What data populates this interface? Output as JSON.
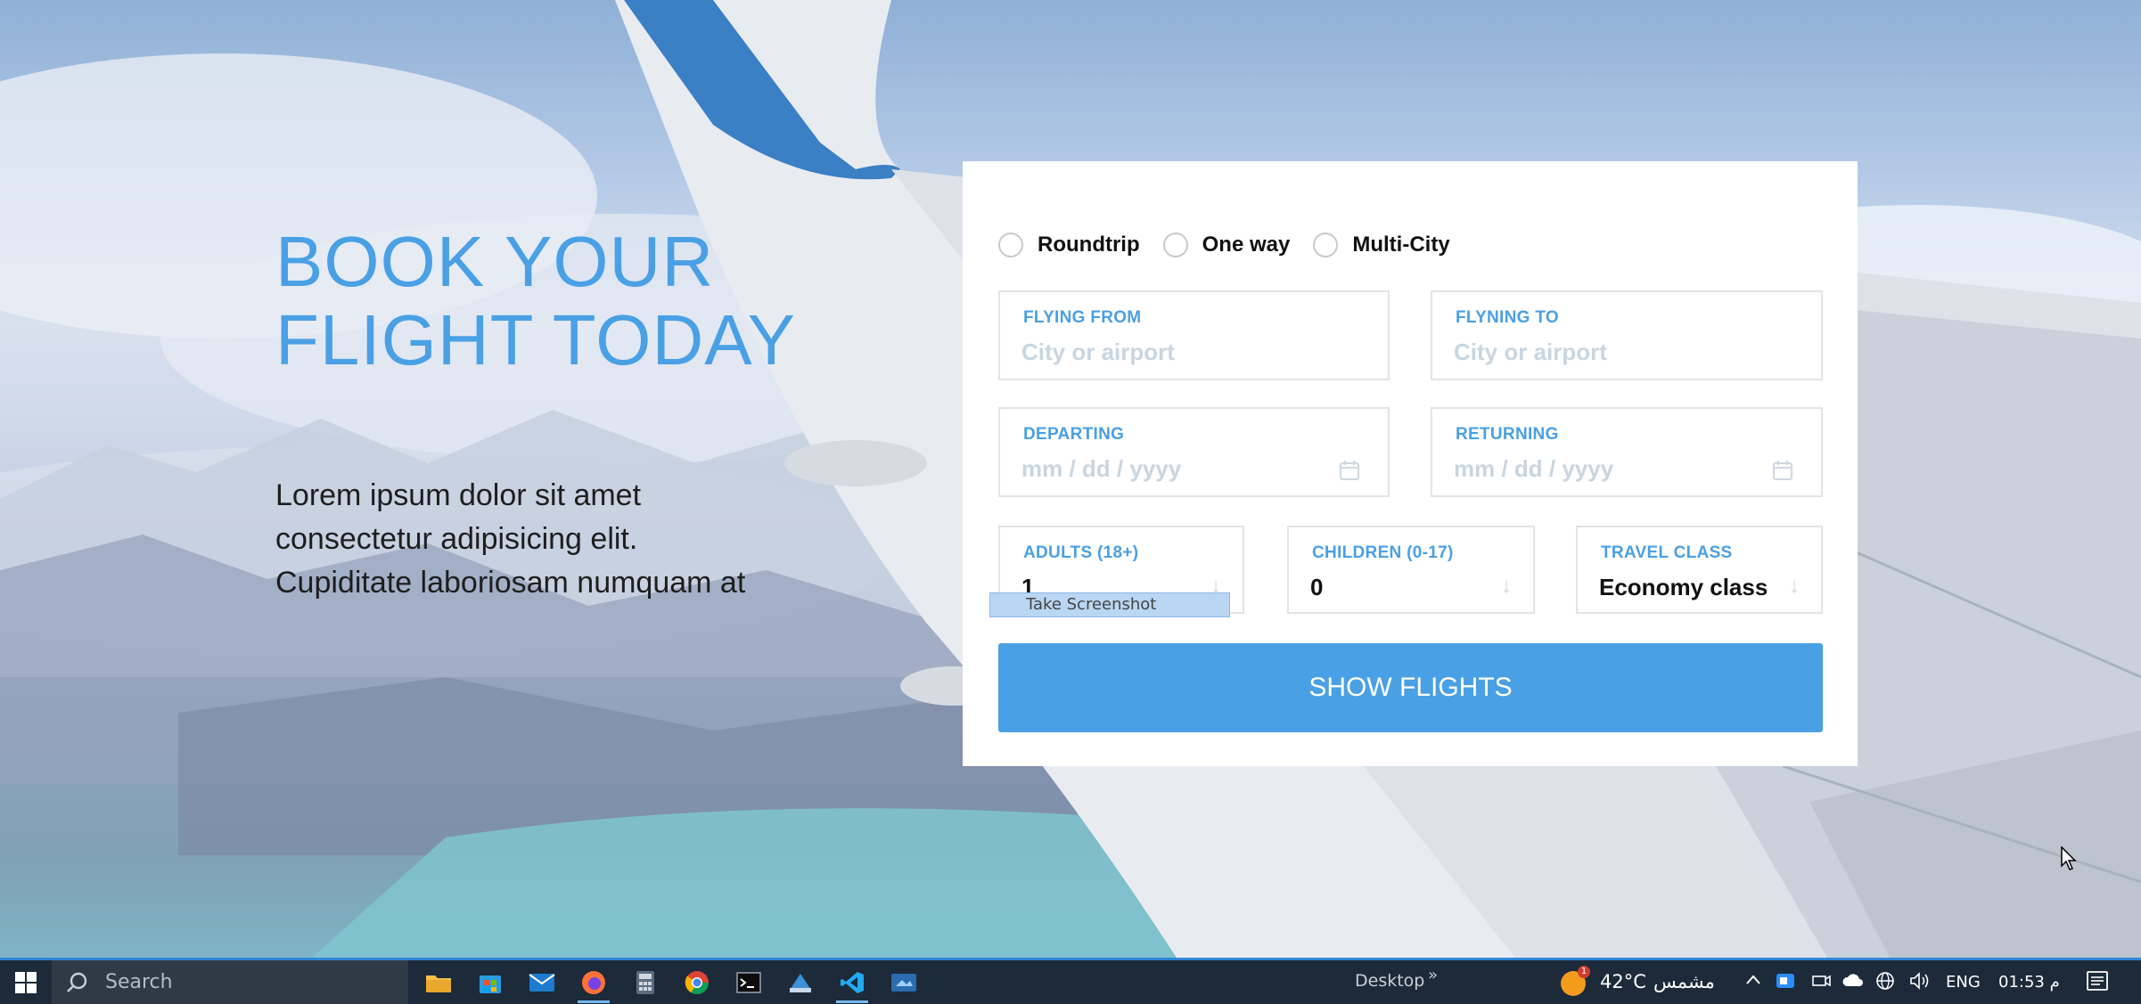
{
  "hero": {
    "title": "BOOK YOUR FLIGHT TODAY",
    "text": "Lorem ipsum dolor sit amet consectetur adipisicing elit. Cupiditate laboriosam numquam at"
  },
  "booking": {
    "trip_types": [
      "Roundtrip",
      "One way",
      "Multi-City"
    ],
    "from": {
      "label": "FLYING FROM",
      "placeholder": "City or airport"
    },
    "to": {
      "label": "FLYNING TO",
      "placeholder": "City or airport"
    },
    "departing": {
      "label": "DEPARTING",
      "placeholder": "mm / dd / yyyy"
    },
    "returning": {
      "label": "RETURNING",
      "placeholder": "mm / dd / yyyy"
    },
    "adults": {
      "label": "ADULTS (18+)",
      "value": "1"
    },
    "children": {
      "label": "CHILDREN (0-17)",
      "value": "0"
    },
    "travel_class": {
      "label": "TRAVEL CLASS",
      "value": "Economy class"
    },
    "tooltip": "Take Screenshot",
    "submit_label": "SHOW FLIGHTS",
    "accent_color": "#4aa0e4"
  },
  "taskbar": {
    "search_placeholder": "Search",
    "desktop_label": "Desktop",
    "weather_badge": "1",
    "temperature": "42°C",
    "condition": "مشمس",
    "language": "ENG",
    "time": "01:53 م",
    "apps": [
      "file-explorer-icon",
      "store-icon",
      "mail-icon",
      "firefox-icon",
      "calculator-icon",
      "chrome-icon",
      "terminal-icon",
      "app-icon",
      "vscode-icon",
      "video-app-icon"
    ]
  }
}
